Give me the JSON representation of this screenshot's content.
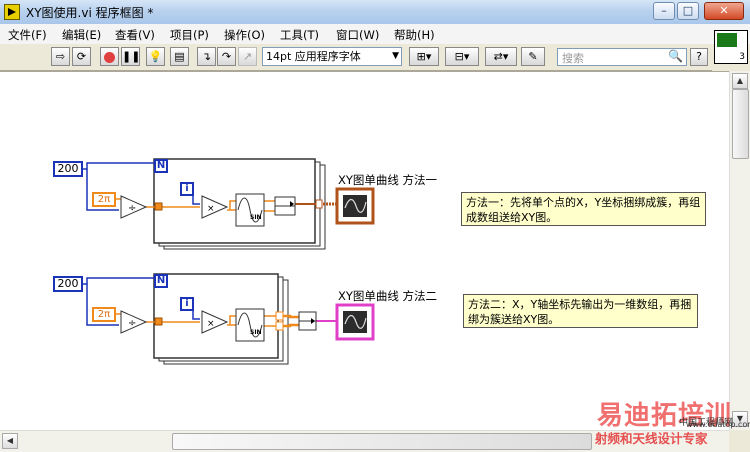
{
  "window": {
    "title": "XY图使用.vi 程序框图 *",
    "minimize": "–",
    "maximize": "□",
    "close": "✕"
  },
  "menu": {
    "items": [
      "文件(F)",
      "编辑(E)",
      "查看(V)",
      "项目(P)",
      "操作(O)",
      "工具(T)",
      "窗口(W)",
      "帮助(H)"
    ]
  },
  "toolbar": {
    "font_select": "14pt 应用程序字体",
    "search_placeholder": "搜索",
    "help": "?",
    "icon_number": "3"
  },
  "diagram": {
    "method1": {
      "count": "200",
      "two_pi": "2π",
      "n_terminal": "N",
      "i_terminal": "i",
      "sin_label": "SIN",
      "graph_label": "XY图单曲线 方法一",
      "comment": "方法一：先将单个点的X，Y坐标捆绑成簇，再组成数组送给XY图。"
    },
    "method2": {
      "count": "200",
      "two_pi": "2π",
      "n_terminal": "N",
      "i_terminal": "i",
      "sin_label": "SIN",
      "graph_label": "XY图单曲线 方法二",
      "comment": "方法二：X，Y轴坐标先输出为一维数组，再捆绑为簇送给XY图。"
    }
  },
  "watermark": {
    "main": "易迪拓培训",
    "sub": "射频和天线设计专家",
    "url": "www.edatop.com",
    "cn": "中国工程师网"
  },
  "colors": {
    "wire_blue": "#1a33b8",
    "wire_orange": "#f08a1a",
    "graph_method1": "#b0531a",
    "graph_method2": "#e040c8"
  }
}
